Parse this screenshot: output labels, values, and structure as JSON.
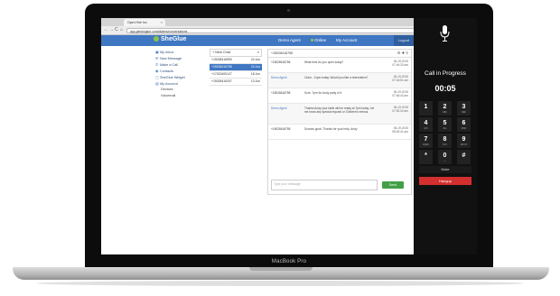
{
  "device": {
    "brand": "MacBook Pro"
  },
  "browser": {
    "tab_title": "Open Hire Inc",
    "tab_close": "×",
    "url": "app.getshoglue.com/dialers/conversations",
    "nav": {
      "back": "←",
      "forward": "→",
      "reload": "C",
      "home": "⌂"
    }
  },
  "app": {
    "logo": "SheGlue",
    "header": {
      "agent": "Demo Agent",
      "status": "Online",
      "account": "My Account",
      "logout": "Logout"
    },
    "sidebar": {
      "items": [
        {
          "icon": "inbox-icon",
          "glyph": "▣",
          "label": "My Inbox"
        },
        {
          "icon": "message-icon",
          "glyph": "✉",
          "label": "New Message"
        },
        {
          "icon": "phone-icon",
          "glyph": "✆",
          "label": "Make a Call"
        },
        {
          "icon": "contacts-icon",
          "glyph": "◉",
          "label": "Contacts"
        },
        {
          "icon": "widget-icon",
          "glyph": "▢",
          "label": "SheGlue Widget"
        },
        {
          "icon": "account-icon",
          "glyph": "▤",
          "label": "My Account"
        }
      ],
      "subitems": [
        "Devices",
        "Voicemail"
      ]
    },
    "conversations": {
      "new_label": "+ New Chat",
      "search_glyph": "⌕",
      "rows": [
        {
          "number": "+15028416590",
          "date": "24 Jun"
        },
        {
          "number": "+15028416755",
          "date": "24 Jun"
        },
        {
          "number": "+17022405127",
          "date": "18 Jun"
        },
        {
          "number": "+15028415207",
          "date": "13 Jun"
        }
      ]
    },
    "thread": {
      "header": "+15028416755",
      "icons": "⚙ ✚ ⚲",
      "messages": [
        {
          "sender": "+15028416755",
          "text": "What time do you open today?",
          "time": "06-19-2015 07:44:33 am"
        },
        {
          "sender": "Demo Agent",
          "text": "11am - 11pm today. Would you like a reservation?",
          "time": "06-19-2015 07:44:51 am"
        },
        {
          "sender": "+15028416755",
          "text": "Sure. 7pm for Andy party of 4",
          "time": "06-19-2015 07:46:43 am"
        },
        {
          "sender": "Demo Agent",
          "text": "Thanks Andy your table will be ready at 7pm today. Let me know any special request or Children's menus.",
          "time": "06-19-2015 07:52:04 am"
        },
        {
          "sender": "+15028416755",
          "text": "Sounds good. Thanks for your help. Andy",
          "time": "06-19-2015 08:00:41 am"
        }
      ],
      "compose_placeholder": "Type your message",
      "send_label": "Send"
    }
  },
  "dialer": {
    "status": "Call in Progress",
    "timer": "00:05",
    "keys": [
      {
        "digit": "1",
        "letters": ""
      },
      {
        "digit": "2",
        "letters": "ABC"
      },
      {
        "digit": "3",
        "letters": "DEF"
      },
      {
        "digit": "4",
        "letters": "GHI"
      },
      {
        "digit": "5",
        "letters": "JKL"
      },
      {
        "digit": "6",
        "letters": "MNO"
      },
      {
        "digit": "7",
        "letters": "PQRS"
      },
      {
        "digit": "8",
        "letters": "TUV"
      },
      {
        "digit": "9",
        "letters": "WXYZ"
      },
      {
        "digit": "*",
        "letters": ""
      },
      {
        "digit": "0",
        "letters": "+"
      },
      {
        "digit": "#",
        "letters": ""
      }
    ],
    "mute_label": "Mute",
    "hangup_label": "Hangup"
  },
  "colors": {
    "primary": "#3f77c3",
    "send": "#43a047",
    "hangup": "#d32f2f",
    "dialer_bg": "#111111"
  }
}
